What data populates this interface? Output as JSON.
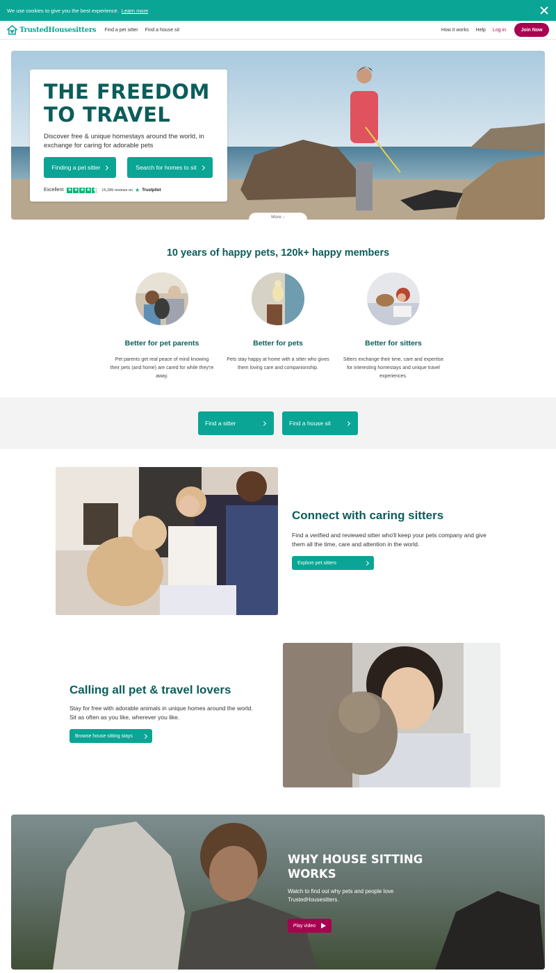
{
  "cookie": {
    "text": "We use cookies to give you the best experience.",
    "link": "Learn more"
  },
  "nav": {
    "logo": "TrustedHousesitters",
    "left_links": [
      "Find a pet sitter",
      "Find a house sit"
    ],
    "right_links": [
      "How it works",
      "Help"
    ],
    "login": "Log in",
    "join": "Join Now"
  },
  "hero": {
    "title_line1": "THE FREEDOM",
    "title_line2": "TO TRAVEL",
    "subtitle": "Discover free & unique homestays around the world, in exchange for caring for adorable pets",
    "btn_sitter": "Finding a pet sitter",
    "btn_homes": "Search for homes to sit",
    "trust_label": "Excellent",
    "trust_stars": 4.5,
    "reviews": "15,289 reviews on",
    "trustpilot": "Trustpilot",
    "more": "More ↓"
  },
  "stats": {
    "title": "10 years of happy pets, 120k+ happy members",
    "columns": [
      {
        "heading": "Better for pet parents",
        "text": "Pet parents get real peace of mind knowing their pets (and home) are cared for while they're away."
      },
      {
        "heading": "Better for pets",
        "text": "Pets stay happy at home with a sitter who gives them loving care and companionship."
      },
      {
        "heading": "Better for sitters",
        "text": "Sitters exchange their time, care and expertise for interesting homestays and unique travel experiences."
      }
    ]
  },
  "band": {
    "btn1": "Find a sitter",
    "btn2": "Find a house sit"
  },
  "feature1": {
    "title": "Connect with caring sitters",
    "text": "Find a verified and reviewed sitter who'll keep your pets company and give them all the time, care and attention in the world.",
    "btn": "Explore pet sitters"
  },
  "feature2": {
    "title": "Calling all pet & travel lovers",
    "text": "Stay for free with adorable animals in unique homes around the world. Sit as often as you like, wherever you like.",
    "btn": "Browse house sitting stays"
  },
  "video": {
    "title_line1": "WHY HOUSE SITTING",
    "title_line2": "WORKS",
    "text": "Watch to find out why pets and people love TrustedHousesitters.",
    "btn": "Play video"
  },
  "colors": {
    "teal": "#0aa594",
    "dark_teal": "#0b5d5a",
    "magenta": "#a8004f",
    "trustpilot_green": "#00b67a"
  }
}
